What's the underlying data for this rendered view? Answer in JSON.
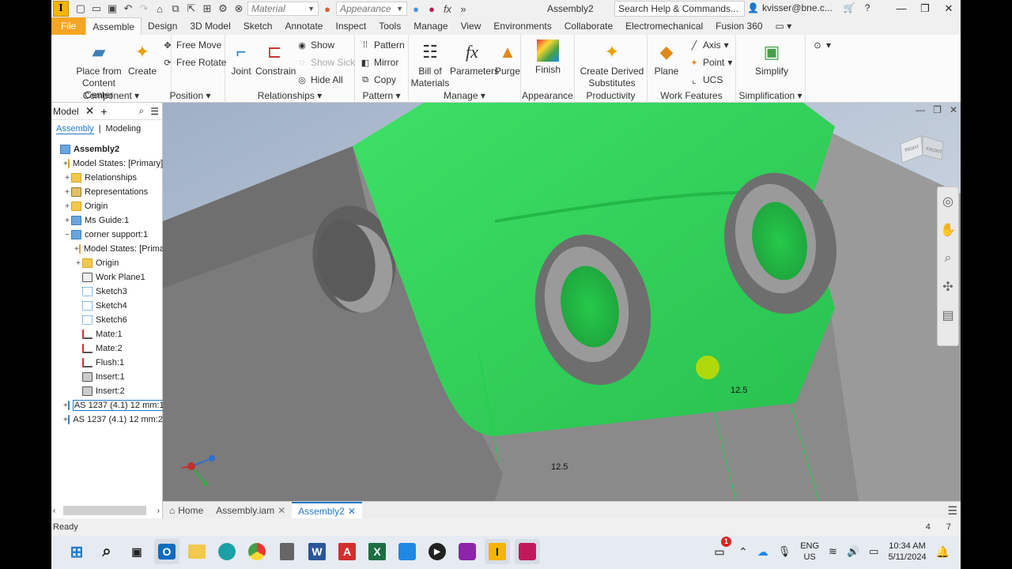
{
  "titlebar": {
    "material_placeholder": "Material",
    "appearance_placeholder": "Appearance",
    "doc_title": "Assembly2",
    "search": "Search Help & Commands...",
    "user": "kvisser@bne.c..."
  },
  "tabs": [
    {
      "label": "File"
    },
    {
      "label": "Assemble"
    },
    {
      "label": "Design"
    },
    {
      "label": "3D Model"
    },
    {
      "label": "Sketch"
    },
    {
      "label": "Annotate"
    },
    {
      "label": "Inspect"
    },
    {
      "label": "Tools"
    },
    {
      "label": "Manage"
    },
    {
      "label": "View"
    },
    {
      "label": "Environments"
    },
    {
      "label": "Collaborate"
    },
    {
      "label": "Electromechanical"
    },
    {
      "label": "Fusion 360"
    }
  ],
  "ribbon": {
    "component": {
      "title": "Component",
      "place": "Place from Content Center",
      "place_l1": "Place from",
      "place_l2": "Content Center",
      "create": "Create"
    },
    "position": {
      "title": "Position",
      "free_move": "Free Move",
      "free_rotate": "Free Rotate"
    },
    "relationships": {
      "title": "Relationships",
      "joint": "Joint",
      "constrain": "Constrain",
      "show": "Show",
      "show_sick": "Show Sick",
      "hide_all": "Hide All"
    },
    "pattern": {
      "title": "Pattern",
      "pattern": "Pattern",
      "mirror": "Mirror",
      "copy": "Copy"
    },
    "manage": {
      "title": "Manage",
      "bom_l1": "Bill of",
      "bom_l2": "Materials",
      "parameters": "Parameters",
      "purge": "Purge"
    },
    "appearance": {
      "title": "Appearance",
      "finish": "Finish"
    },
    "productivity": {
      "title": "Productivity",
      "cds_l1": "Create Derived",
      "cds_l2": "Substitutes"
    },
    "work_features": {
      "title": "Work Features",
      "plane": "Plane",
      "axis": "Axis",
      "point": "Point",
      "ucs": "UCS"
    },
    "simplification": {
      "title": "Simplification",
      "simplify": "Simplify"
    }
  },
  "browser": {
    "title": "Model",
    "sub_assembly": "Assembly",
    "sub_modeling": "Modeling",
    "tree": [
      {
        "label": "Assembly2",
        "indent": 0,
        "pm": "",
        "icon": "part",
        "bold": true
      },
      {
        "label": "Model States: [Primary]",
        "indent": 1,
        "pm": "+",
        "icon": "fold"
      },
      {
        "label": "Relationships",
        "indent": 1,
        "pm": "+",
        "icon": "fold"
      },
      {
        "label": "Representations",
        "indent": 1,
        "pm": "+",
        "icon": "rep"
      },
      {
        "label": "Origin",
        "indent": 1,
        "pm": "+",
        "icon": "fold"
      },
      {
        "label": "Ms Guide:1",
        "indent": 1,
        "pm": "+",
        "icon": "part"
      },
      {
        "label": "corner support:1",
        "indent": 1,
        "pm": "−",
        "icon": "part"
      },
      {
        "label": "Model States: [Primary]",
        "indent": 2,
        "pm": "+",
        "icon": "fold"
      },
      {
        "label": "Origin",
        "indent": 2,
        "pm": "+",
        "icon": "fold"
      },
      {
        "label": "Work Plane1",
        "indent": 2,
        "pm": "",
        "icon": "plane"
      },
      {
        "label": "Sketch3",
        "indent": 2,
        "pm": "",
        "icon": "sketch"
      },
      {
        "label": "Sketch4",
        "indent": 2,
        "pm": "",
        "icon": "sketch"
      },
      {
        "label": "Sketch6",
        "indent": 2,
        "pm": "",
        "icon": "sketch"
      },
      {
        "label": "Mate:1",
        "indent": 2,
        "pm": "",
        "icon": "mate"
      },
      {
        "label": "Mate:2",
        "indent": 2,
        "pm": "",
        "icon": "mate"
      },
      {
        "label": "Flush:1",
        "indent": 2,
        "pm": "",
        "icon": "mate"
      },
      {
        "label": "Insert:1",
        "indent": 2,
        "pm": "",
        "icon": "ins"
      },
      {
        "label": "Insert:2",
        "indent": 2,
        "pm": "",
        "icon": "ins"
      },
      {
        "label": "AS 1237 (4.1) 12 mm:1",
        "indent": 1,
        "pm": "+",
        "icon": "part",
        "selected": true
      },
      {
        "label": "AS 1237 (4.1) 12 mm:2",
        "indent": 1,
        "pm": "+",
        "icon": "part"
      }
    ]
  },
  "viewport": {
    "dim1": "12.5",
    "dim2": "12.5",
    "viewcube_left": "RIGHT",
    "viewcube_right": "FRONT"
  },
  "doctabs": {
    "home": "Home",
    "tab1": "Assembly.iam",
    "tab2": "Assembly2"
  },
  "status": {
    "text": "Ready",
    "num1": "4",
    "num2": "7"
  },
  "taskbar": {
    "lang1": "ENG",
    "lang2": "US",
    "time": "10:34 AM",
    "date": "5/11/2024",
    "badge": "1"
  },
  "colors": {
    "accent": "#1f78c8",
    "selection_green": "#2fd85a",
    "file_tab": "#f5a623"
  }
}
